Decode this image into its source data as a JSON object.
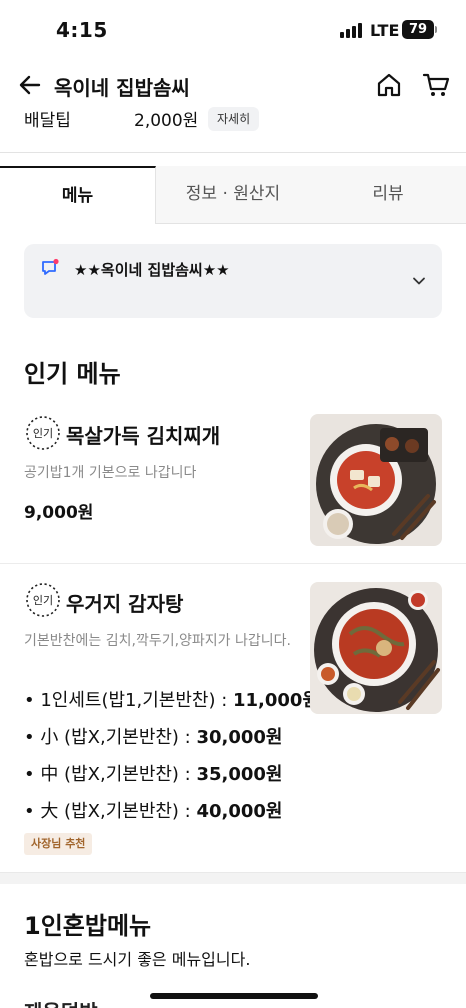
{
  "status_bar": {
    "time": "4:15",
    "network": "LTE",
    "battery": "79"
  },
  "header": {
    "title": "옥이네 집밥솜씨",
    "back_icon": "arrow-left-icon",
    "home_icon": "home-icon",
    "cart_icon": "cart-icon"
  },
  "delivery": {
    "label": "배달팁",
    "value": "2,000원",
    "detail_label": "자세히"
  },
  "tabs": [
    {
      "label": "메뉴",
      "active": true
    },
    {
      "label": "정보 · 원산지",
      "active": false
    },
    {
      "label": "리뷰",
      "active": false
    }
  ],
  "notice": {
    "text": "★★옥이네 집밥솜씨★★",
    "icon": "speech-bubble-icon"
  },
  "popular": {
    "title": "인기 메뉴",
    "badge_text": "인기",
    "items": [
      {
        "name": "목살가득 김치찌개",
        "description": "공기밥1개 기본으로 나갑니다",
        "price": "9,000원"
      },
      {
        "name": "우거지 감자탕",
        "description": "기본반찬에는 김치,깍두기,양파지가 나갑니다.",
        "options": [
          {
            "label": "• 1인세트(밥1,기본반찬) : ",
            "price": "11,000원"
          },
          {
            "label": "• 小 (밥X,기본반찬) : ",
            "price": "30,000원"
          },
          {
            "label": "• 中 (밥X,기본반찬) : ",
            "price": "35,000원"
          },
          {
            "label": "• 大 (밥X,기본반찬) : ",
            "price": "40,000원"
          }
        ],
        "tag": "사장님 추천"
      }
    ]
  },
  "solo": {
    "title": "1인혼밥메뉴",
    "subtitle": "혼밥으로 드시기 좋은 메뉴입니다.",
    "next_item_partial": "제육덮밥"
  },
  "colors": {
    "accent_blue": "#2f6bff",
    "notice_dot": "#ff3b6b",
    "tag_bg": "#f6ece3",
    "tag_text": "#a1652c"
  }
}
